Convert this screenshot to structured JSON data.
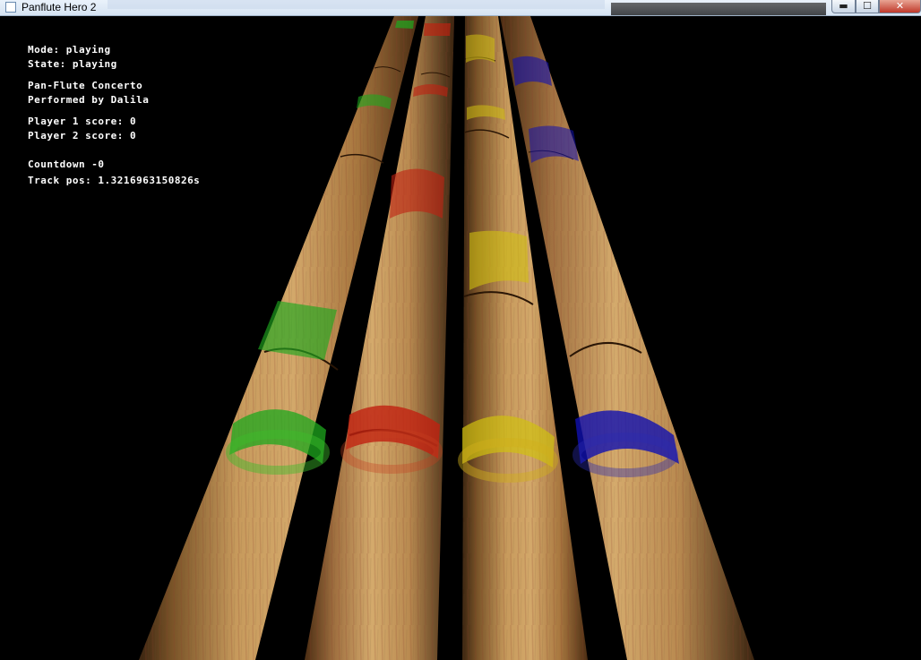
{
  "window": {
    "title": "Panflute Hero 2",
    "controls": {
      "minimize": "▬",
      "maximize": "☐",
      "close": "✕"
    }
  },
  "hud": {
    "mode": "Mode: playing",
    "state": "State: playing",
    "song_title": "Pan-Flute Concerto",
    "performer": "Performed by Dalila",
    "player1_score": "Player 1 score: 0",
    "player2_score": "Player 2 score: 0",
    "countdown": "Countdown -0",
    "track_pos": "Track pos: 1.3216963150826s"
  },
  "lanes": [
    {
      "color_name": "green",
      "color": "#1ea81e"
    },
    {
      "color_name": "red",
      "color": "#c02010"
    },
    {
      "color_name": "yellow",
      "color": "#d0c010"
    },
    {
      "color_name": "blue",
      "color": "#1010b0"
    }
  ]
}
